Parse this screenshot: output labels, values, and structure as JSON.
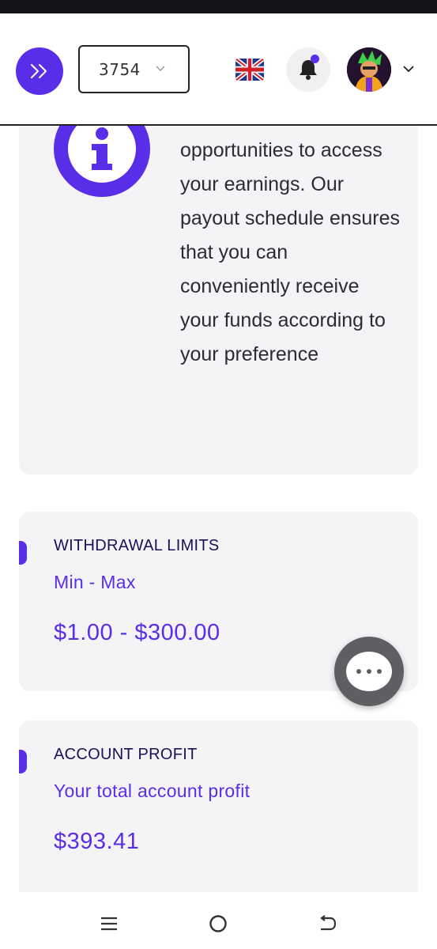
{
  "header": {
    "account_number": "3754",
    "language_icon": "uk-flag-icon",
    "has_notification": true
  },
  "info": {
    "text": "opportunities to access your earnings. Our payout schedule ensures that you can conveniently receive your funds according to your preference"
  },
  "withdrawal": {
    "title": "WITHDRAWAL LIMITS",
    "subtitle": "Min - Max",
    "value": "$1.00 - $300.00"
  },
  "profit": {
    "title": "ACCOUNT PROFIT",
    "subtitle": "Your total account profit",
    "value": "$393.41"
  },
  "colors": {
    "accent": "#5a2ee8",
    "card_bg": "#f4f4f6",
    "title_dark": "#1c0f55"
  },
  "nav": {
    "icons": [
      "menu-icon",
      "home-icon",
      "back-icon"
    ]
  }
}
